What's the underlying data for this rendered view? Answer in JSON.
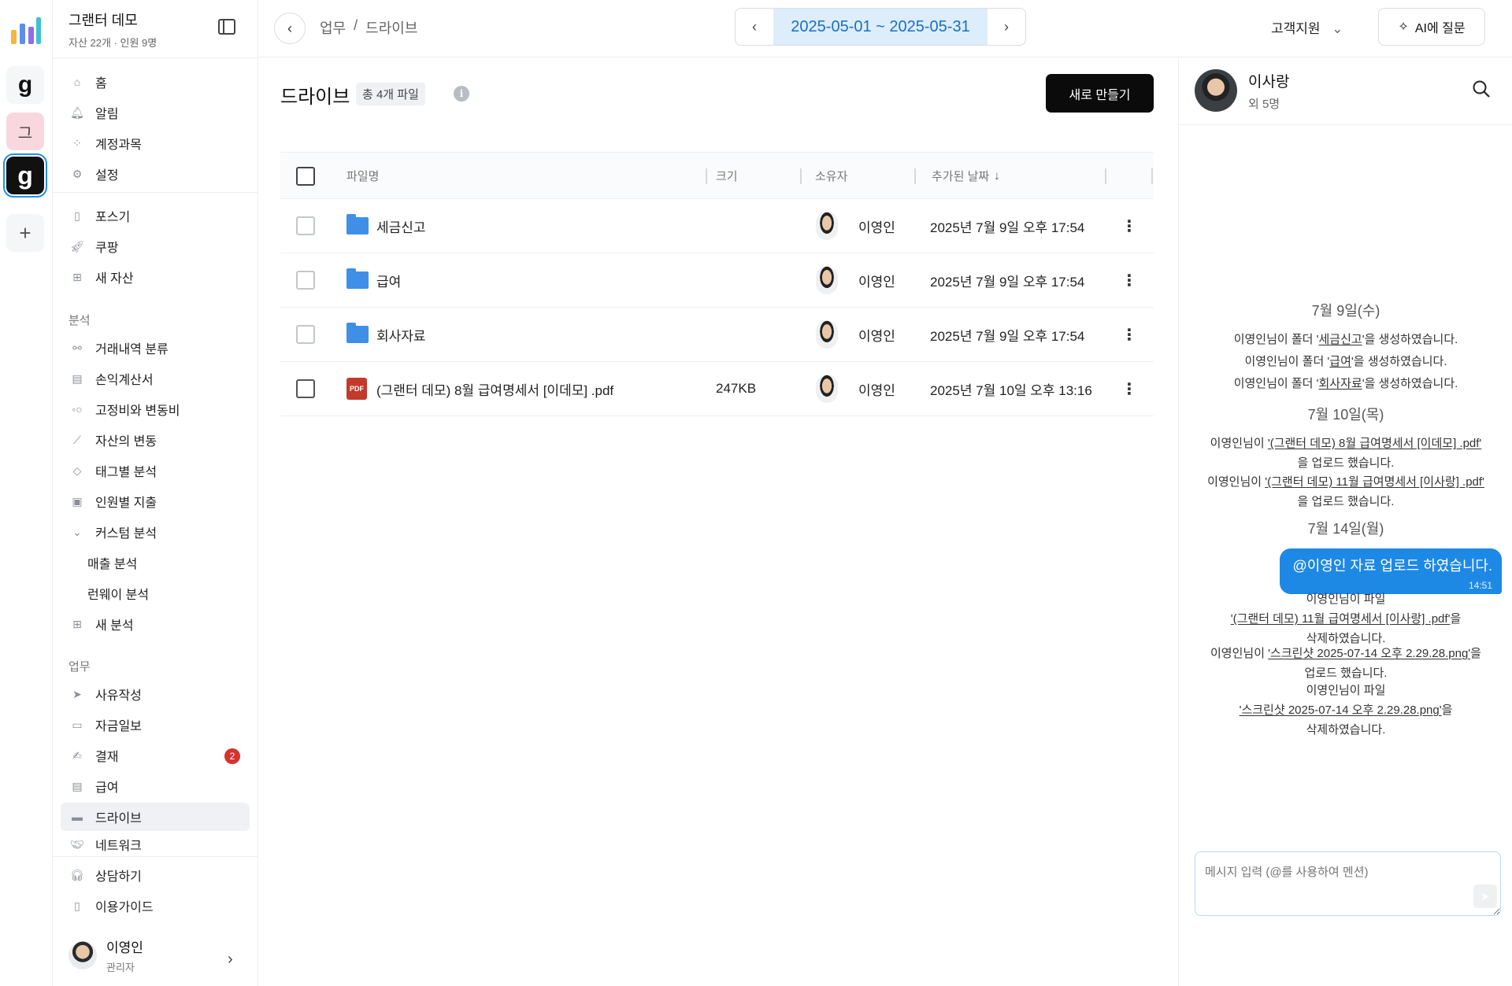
{
  "org": {
    "name": "그랜터 데모",
    "meta": "자산 22개 · 인원 9명"
  },
  "rail": {
    "g1": "g",
    "k": "그",
    "g2": "g",
    "add": "+"
  },
  "nav": {
    "home": "홈",
    "alerts": "알림",
    "accounts": "계정과목",
    "settings": "설정",
    "pos": "포스기",
    "coupang": "쿠팡",
    "new_asset": "새 자산",
    "analysis_label": "분석",
    "tx_class": "거래내역 분류",
    "pl": "손익계산서",
    "fixed_var": "고정비와 변동비",
    "asset_change": "자산의 변동",
    "tag_analysis": "태그별 분석",
    "person_spend": "인원별 지출",
    "custom_analysis": "커스텀 분석",
    "sales_analysis": "매출 분석",
    "runway_analysis": "런웨이 분석",
    "new_analysis": "새 분석",
    "work_label": "업무",
    "reason": "사유작성",
    "daily_fund": "자금일보",
    "approval": "결재",
    "approval_badge": "2",
    "payroll": "급여",
    "drive": "드라이브",
    "network": "네트워크",
    "consult": "상담하기",
    "guide": "이용가이드"
  },
  "user": {
    "name": "이영인",
    "role": "관리자"
  },
  "header": {
    "breadcrumb_1": "업무",
    "breadcrumb_sep": "/",
    "breadcrumb_2": "드라이브",
    "date_range": "2025-05-01 ~ 2025-05-31",
    "support": "고객지원",
    "ai_button": "AI에 질문"
  },
  "main": {
    "title": "드라이브",
    "file_count": "총 4개 파일",
    "new_button": "새로 만들기",
    "columns": {
      "name": "파일명",
      "size": "크기",
      "owner": "소유자",
      "date": "추가된 날짜"
    },
    "files": [
      {
        "name": "세금신고",
        "type": "folder",
        "size": "",
        "owner": "이영인",
        "date": "2025년 7월 9일 오후 17:54"
      },
      {
        "name": "급여",
        "type": "folder",
        "size": "",
        "owner": "이영인",
        "date": "2025년 7월 9일 오후 17:54"
      },
      {
        "name": "회사자료",
        "type": "folder",
        "size": "",
        "owner": "이영인",
        "date": "2025년 7월 9일 오후 17:54"
      },
      {
        "name": "(그랜터 데모) 8월 급여명세서 [이데모] .pdf",
        "type": "pdf",
        "size": "247KB",
        "owner": "이영인",
        "date": "2025년 7월 10일 오후 13:16"
      }
    ]
  },
  "chat": {
    "name": "이사랑",
    "sub": "외 5명",
    "day1": "7월 9일(수)",
    "m1_pre": "이영인님이 폴더 '",
    "m1_link": "세금신고",
    "m1_post": "'을 생성하였습니다.",
    "m2_pre": "이영인님이 폴더 '",
    "m2_link": "급여",
    "m2_post": "'을 생성하였습니다.",
    "m3_pre": "이영인님이 폴더 '",
    "m3_link": "회사자료",
    "m3_post": "'을 생성하였습니다.",
    "day2": "7월 10일(목)",
    "m4_pre": "이영인님이 ",
    "m4_link": "'(그랜터 데모) 8월 급여명세서 [이데모] .pdf'",
    "m4_post": "을 업로드 했습니다.",
    "m5_pre": "이영인님이 ",
    "m5_link": "'(그랜터 데모) 11월 급여명세서 [이사랑] .pdf'",
    "m5_post": "을 업로드 했습니다.",
    "day3": "7월 14일(월)",
    "bubble_text": "@이영인 자료 업로드 하였습니다.",
    "bubble_time": "14:51",
    "m6_pre": "이영인님이 파일",
    "m6_link": "'(그랜터 데모) 11월 급여명세서 [이사랑] .pdf'",
    "m6_post": "을",
    "m6_end": "삭제하였습니다.",
    "m7_pre": "이영인님이 ",
    "m7_link": "'스크린샷 2025-07-14 오후 2.29.28.png'",
    "m7_post": "을",
    "m7_end": "업로드 했습니다.",
    "m8_pre": "이영인님이 파일",
    "m8_link": "'스크린샷 2025-07-14 오후 2.29.28.png'",
    "m8_post": "을",
    "m8_end": "삭제하였습니다.",
    "input_placeholder": "메시지 입력 (@를 사용하여 멘션)"
  }
}
